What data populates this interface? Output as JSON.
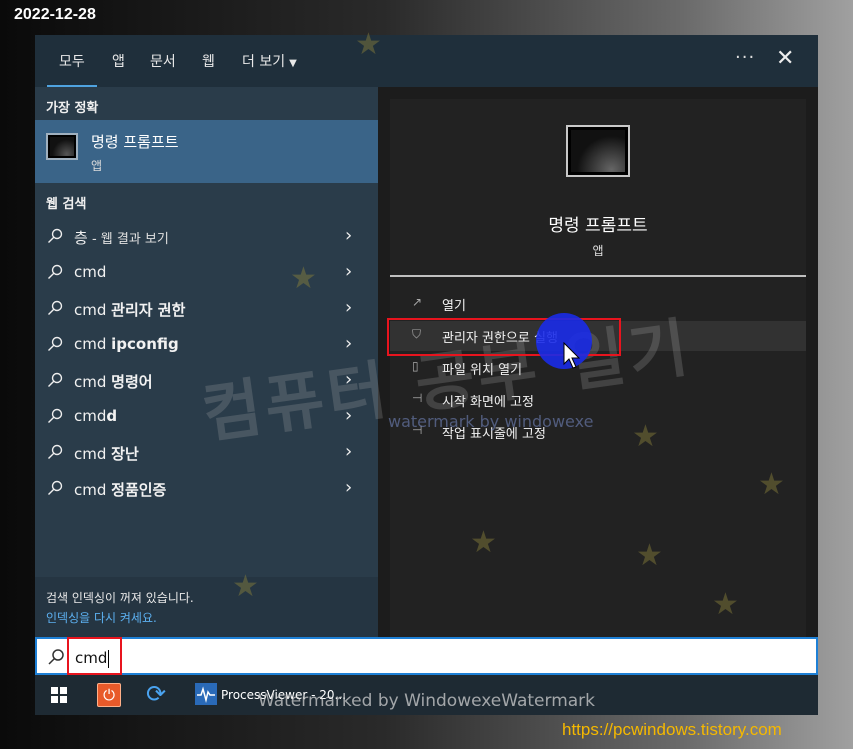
{
  "stamp_date": "2022-12-28",
  "tabs": [
    {
      "label": "모두"
    },
    {
      "label": "앱"
    },
    {
      "label": "문서"
    },
    {
      "label": "웹"
    },
    {
      "label": "더 보기"
    }
  ],
  "more_options_label": "···",
  "close_label": "✕",
  "left": {
    "best_match_heading": "가장 정확",
    "best_match": {
      "title": "명령 프롬프트",
      "subtitle": "앱"
    },
    "web_heading": "웹 검색",
    "results": [
      {
        "prefix": "층",
        "suffix": " - 웹 결과 보기"
      },
      {
        "prefix": "cmd",
        "suffix": ""
      },
      {
        "prefix": "cmd ",
        "suffix": "관리자 권한"
      },
      {
        "prefix": "cmd ",
        "suffix": "ipconfig"
      },
      {
        "prefix": "cmd ",
        "suffix": "명령어"
      },
      {
        "prefix": "cmd",
        "suffix": "d"
      },
      {
        "prefix": "cmd ",
        "suffix": "장난"
      },
      {
        "prefix": "cmd ",
        "suffix": "정품인증"
      }
    ],
    "notice_line": "검색 인덱싱이 꺼져 있습니다.",
    "notice_link": "인덱싱을 다시 켜세요."
  },
  "right": {
    "app_title": "명령 프롬프트",
    "app_subtitle": "앱",
    "actions": [
      {
        "label": "열기",
        "icon": "open-icon"
      },
      {
        "label": "관리자 권한으로 실행",
        "icon": "shield-icon"
      },
      {
        "label": "파일 위치 열기",
        "icon": "file-icon"
      },
      {
        "label": "시작 화면에 고정",
        "icon": "pin-icon"
      },
      {
        "label": "작업 표시줄에 고정",
        "icon": "pin-icon"
      }
    ]
  },
  "search": {
    "value": "cmd"
  },
  "taskbar": {
    "items": [
      {
        "icon": "windows-start-icon"
      },
      {
        "icon": "power-icon"
      },
      {
        "icon": "refresh-icon"
      },
      {
        "icon": "processviewer-icon",
        "label": "ProcessViewer - 20..."
      }
    ]
  },
  "watermarks": {
    "korean": "컴퓨터 공부 일기",
    "small": "watermark by windowexe",
    "bottom": "Watermarked by WindowexeWatermark",
    "url": "https://pcwindows.tistory.com"
  },
  "colors": {
    "accent": "#1e80d6",
    "selection": "#3a6488",
    "highlight_box": "#e8141e",
    "url_text": "#f5b800"
  }
}
